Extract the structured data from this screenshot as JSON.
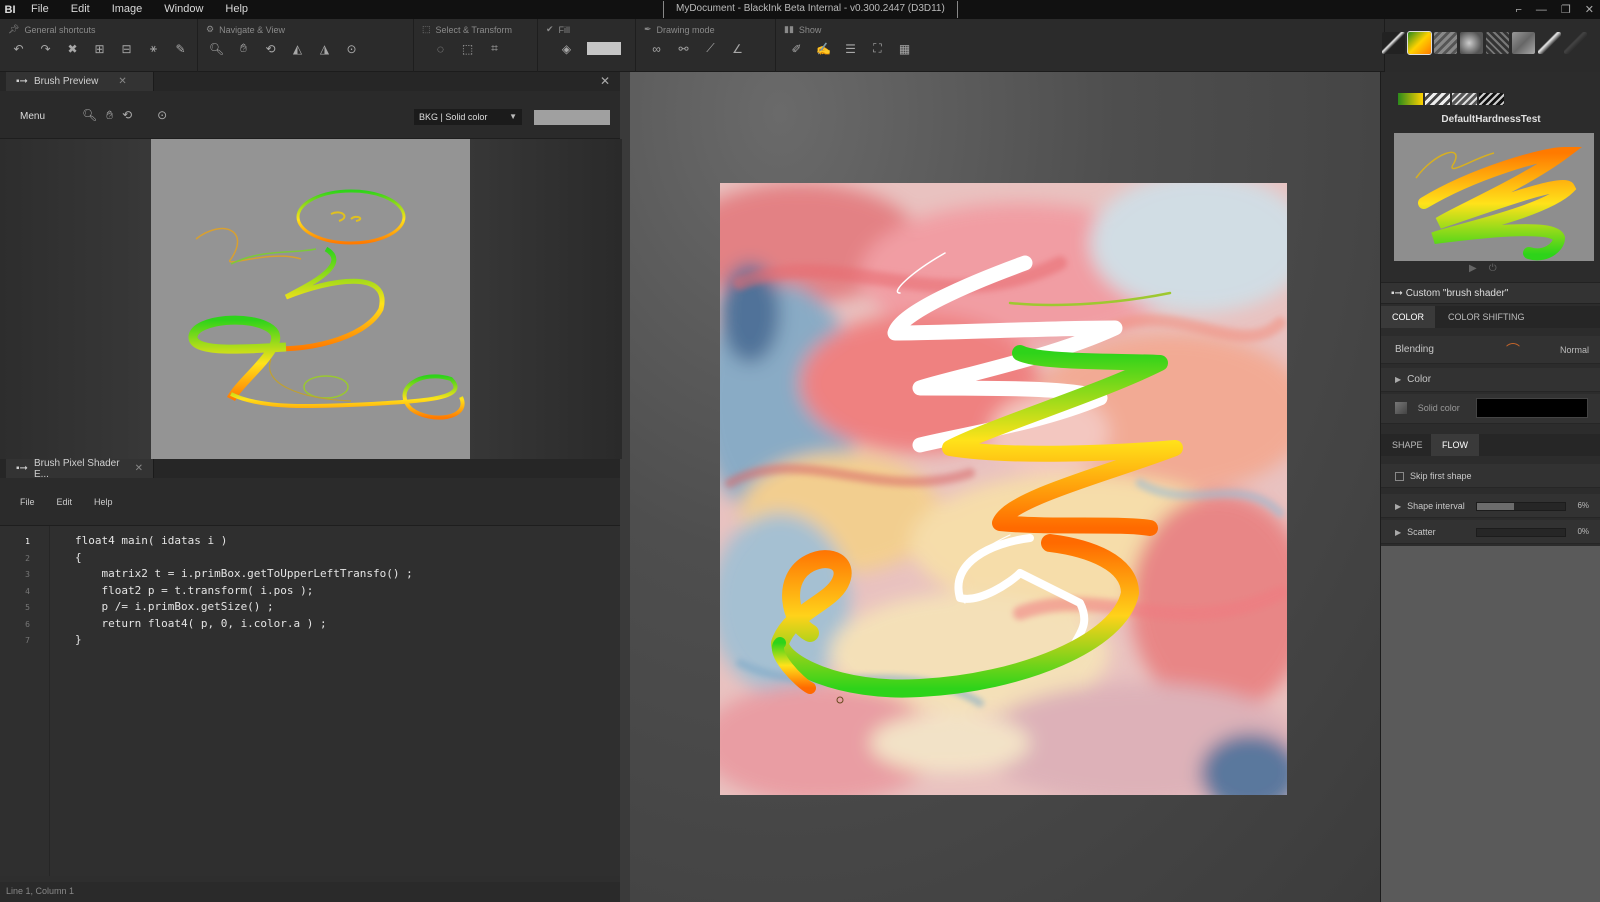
{
  "app": {
    "logo": "BI",
    "window_title": "MyDocument - BlackInk Beta Internal - v0.300.2447 (D3D11)",
    "menu": [
      "File",
      "Edit",
      "Image",
      "Window",
      "Help"
    ]
  },
  "toolbar": {
    "groups": [
      {
        "title": "General shortcuts",
        "icon": "pin-icon"
      },
      {
        "title": "Navigate & View",
        "icon": "gear-icon"
      },
      {
        "title": "Select & Transform",
        "icon": "select-icon"
      },
      {
        "title": "Fill",
        "icon": "fill-icon"
      },
      {
        "title": "Drawing mode",
        "icon": "pen-icon"
      },
      {
        "title": "Show",
        "icon": "show-icon"
      }
    ]
  },
  "brush_preview_panel": {
    "tab_label": "Brush Preview",
    "menu_label": "Menu",
    "bkg_select": "BKG | Solid color",
    "bkg_color": "#a0a0a0"
  },
  "shader_panel": {
    "tab_label": "Brush Pixel Shader E...",
    "menu": [
      "File",
      "Edit",
      "Help"
    ],
    "line_numbers": [
      "1",
      "2",
      "3",
      "4",
      "5",
      "6",
      "7"
    ],
    "code_lines": [
      "float4 main( idatas i )",
      "{",
      "    matrix2 t = i.primBox.getToUpperLeftTransfo() ;",
      "    float2 p = t.transform( i.pos );",
      "    p /= i.primBox.getSize() ;",
      "    return float4( p, 0, i.color.a ) ;",
      "}"
    ],
    "status": "Line 1, Column 1"
  },
  "right_panel": {
    "preset_name": "DefaultHardnessTest",
    "section_title": "Custom \"brush shader\"",
    "tabs1": [
      "COLOR",
      "COLOR SHIFTING"
    ],
    "blending_label": "Blending",
    "blending_value": "Normal",
    "color_label": "Color",
    "solid_color_label": "Solid color",
    "solid_color_value": "#000000",
    "tabs2": [
      "SHAPE",
      "FLOW"
    ],
    "skip_first_shape": "Skip first shape",
    "shape_interval_label": "Shape interval",
    "shape_interval_value": "6%",
    "shape_interval_fraction": 0.06,
    "scatter_label": "Scatter",
    "scatter_value": "0%",
    "scatter_fraction": 0.0
  },
  "colors": {
    "stroke_green": "#22c21a",
    "stroke_orange": "#ff7a00",
    "stroke_yellow": "#ffe21a"
  }
}
